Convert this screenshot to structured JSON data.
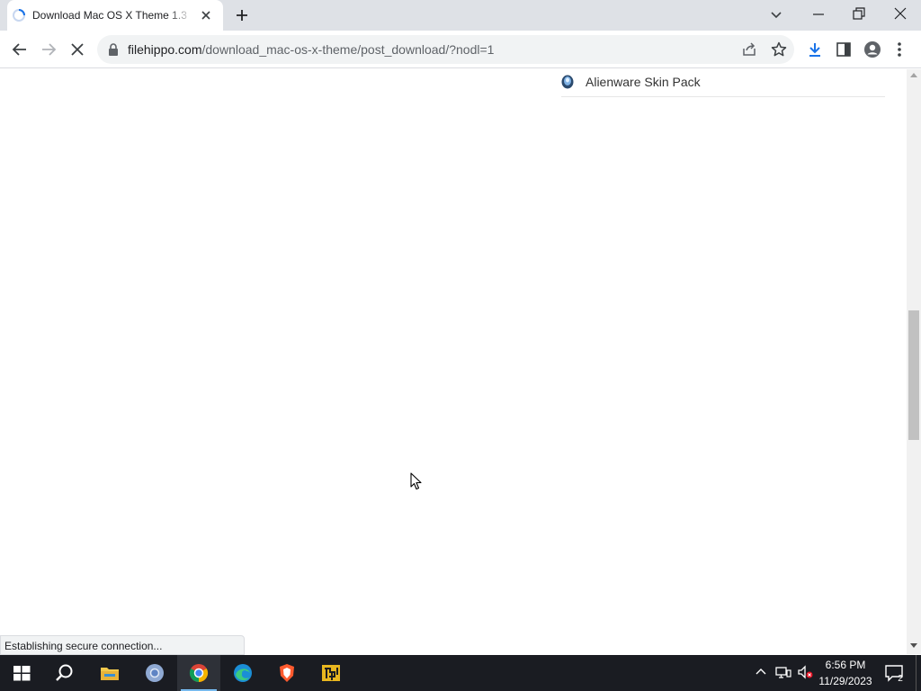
{
  "browser": {
    "tab": {
      "title": "Download Mac OS X Theme 1.3",
      "loading": true,
      "spinner_icon": "loading-spinner-icon",
      "close_icon": "close-icon"
    },
    "new_tab_icon": "plus-icon",
    "tab_search_icon": "chevron-down-icon",
    "window_controls": [
      "minimize-icon",
      "restore-icon",
      "close-icon"
    ],
    "toolbar": {
      "back_icon": "arrow-left-icon",
      "forward_icon": "arrow-right-icon",
      "stop_icon": "stop-x-icon",
      "lock_icon": "lock-icon",
      "url_host": "filehippo.com",
      "url_path": "/download_mac-os-x-theme/post_download/?nodl=1",
      "share_icon": "share-icon",
      "bookmark_icon": "star-icon",
      "download_icon": "download-icon",
      "side_panel_icon": "side-panel-icon",
      "profile_icon": "profile-icon",
      "menu_icon": "kebab-menu-icon"
    },
    "status_bubble": "Establishing secure connection..."
  },
  "page": {
    "related_programs": [
      {
        "label": "Alienware Skin Pack",
        "icon": "alienware-logo-icon"
      }
    ]
  },
  "taskbar": {
    "items": [
      {
        "name": "start",
        "icon": "windows-logo-icon"
      },
      {
        "name": "search",
        "icon": "search-icon"
      },
      {
        "name": "file-explorer",
        "icon": "folder-icon"
      },
      {
        "name": "chromium",
        "icon": "chromium-icon"
      },
      {
        "name": "chrome",
        "icon": "chrome-icon",
        "active": true
      },
      {
        "name": "edge",
        "icon": "edge-icon"
      },
      {
        "name": "brave",
        "icon": "brave-icon"
      },
      {
        "name": "app",
        "icon": "app-icon"
      }
    ],
    "tray": {
      "chevron_icon": "chevron-up-icon",
      "network_icon": "network-icon",
      "volume_icon": "volume-muted-icon",
      "time": "6:56 PM",
      "date": "11/29/2023",
      "notifications_count": "2",
      "notification_icon": "action-center-icon"
    }
  },
  "colors": {
    "tabstrip_bg": "#dee1e6",
    "omnibox_bg": "#f1f3f4",
    "taskbar_bg": "#1a1c22",
    "accent": "#1a73e8"
  }
}
